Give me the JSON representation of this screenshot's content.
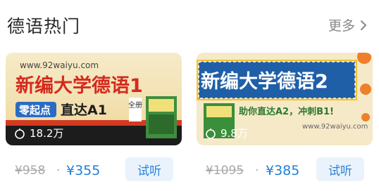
{
  "header": {
    "title": "德语热门",
    "more_label": "更多"
  },
  "courses": [
    {
      "cover": {
        "url_text": "www.92waiyu.com",
        "title_line1": "新编大学德语1",
        "badge": "零起点",
        "tagline": "直达A1",
        "corner": "全册"
      },
      "views": "18.2万",
      "original_price": "¥958",
      "separator": "·",
      "price": "¥355",
      "button_label": "试听"
    },
    {
      "cover": {
        "title": "新编大学德语2",
        "tagline": "助你直达A2，冲刺B1!",
        "url_text": "www.92waiyu.com"
      },
      "views": "9.8万",
      "original_price": "¥1095",
      "separator": "·",
      "price": "¥385",
      "button_label": "试听"
    }
  ],
  "colors": {
    "accent": "#1e7fd6",
    "cover1_bg": "#f4e3b4",
    "cover1_title": "#d52a1f",
    "cover2_bg": "#1f5fa8",
    "cover2_frame": "#f2c230"
  }
}
